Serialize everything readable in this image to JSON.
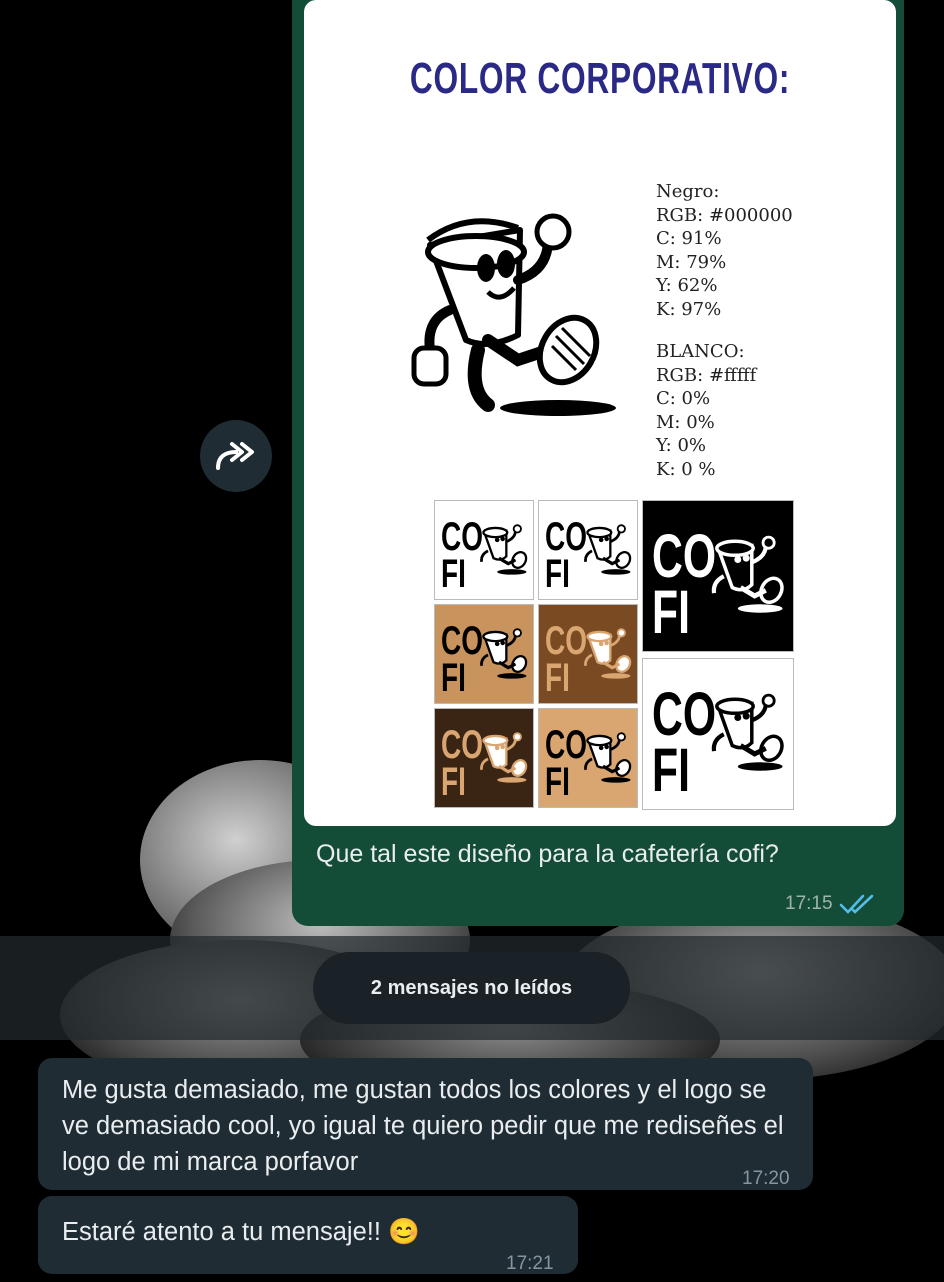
{
  "forward": {
    "icon": "forward-icon"
  },
  "image_card": {
    "title": "COLOR CORPORATIVO:",
    "negro": [
      "Negro:",
      "RGB:  #000000",
      "C: 91%",
      "M: 79%",
      "Y: 62%",
      "K: 97%"
    ],
    "blanco": [
      "BLANCO:",
      "RGB:  #fffff",
      "C: 0%",
      "M: 0%",
      "Y: 0%",
      "K: 0 %"
    ],
    "logo_top": "CO",
    "logo_bottom": "FI",
    "tile_colors": [
      "#ffffff",
      "#ffffff",
      "#000000",
      "#c8935c",
      "#7a4a23",
      "#ffffff",
      "#3a2414",
      "#d9a570"
    ]
  },
  "outgoing_message": {
    "caption": "Que tal este diseño para la cafetería cofi?",
    "time": "17:15",
    "status_icon": "double-check-read-icon"
  },
  "unread_divider": {
    "label": "2 mensajes no leídos"
  },
  "incoming_messages": [
    {
      "text": "Me gusta demasiado, me gustan todos los colores y el logo se ve demasiado cool, yo igual te quiero pedir que me rediseñes el logo de mi marca porfavor",
      "time": "17:20"
    },
    {
      "text": "Estaré atento a tu mensaje!! 😊",
      "time": "17:21"
    }
  ],
  "colors": {
    "outgoing_bubble": "#144d37",
    "incoming_bubble": "#1f2c33",
    "read_tick": "#53bdeb",
    "title": "#2a2a86"
  }
}
